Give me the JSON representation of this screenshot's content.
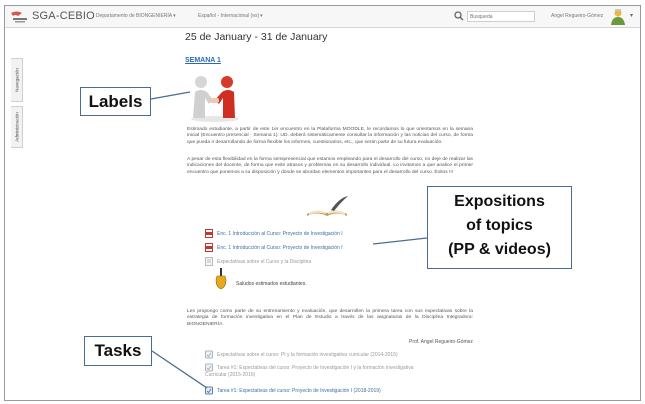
{
  "navbar": {
    "brand": "SGA-CEBIO",
    "menus": [
      {
        "label": "Departamento de BIONGENIERÍA",
        "caret": "▾"
      },
      {
        "label": "Español - Internacional (es)",
        "caret": "▾"
      }
    ],
    "search_placeholder": "Busqueda",
    "user_name": "Angel Regueiro-Gómez",
    "user_caret": "▾"
  },
  "sidebar": {
    "tabs": [
      {
        "label": "Navegación"
      },
      {
        "label": "Administración"
      }
    ]
  },
  "course": {
    "week_title": "25 de January - 31 de January",
    "section_link": "SEMANA 1",
    "intro_paragraph": "Estimado estudiante, a partir de este 1er encuentro en la Plataforma MOODLE, le recordamos lo que orientamos en la semana inicial (Encuentro presencial - Semana 1): UD. deberá sistemáticamente consultar la información y las noticias del curso, de forma que pueda ir desarrollando de forma flexible los informes, cuestionarios, etc., que serán parte de su futura evaluación.",
    "flex_paragraph": "A pesar de esta flexibilidad en la forma semipresencial que estamos empleando para el desarrollo del curso, no deje de realizar las indicaciones del docente, de forma que evite atrasos y problemas en su desarrollo individual. Lo invitamos a que analice el primer encuentro que ponemos a su disposición y donde se abordan elementos importantes para el desarrollo del curso. Éxitos !!!",
    "resources": [
      {
        "label": "Enc. 1 Introducción al Curso: Proyecto de Investigación I",
        "icon": "pdf-icon"
      },
      {
        "label": "Enc. 1 Introducción al Curso: Proyecto de Investigación I",
        "icon": "pdf-icon"
      },
      {
        "label": "Expectativas sobre el Curso y la Disciplina",
        "icon": "document-icon"
      }
    ],
    "greeting": "Saludos estimados estudiantes.",
    "task_paragraph": "Les propongo como parte de su entrenamiento y evaluación, que desarrollen la primera tarea con sus expectativas sobre la estrategia de formación investigativa en el Plan de Estudio a través de las asignaturas de la Disciplina Integradora: BIONGENIERÍA.",
    "signature": "Prof. Angel Regueiro-Gómez",
    "tasks": [
      {
        "label": "Expectativas sobre el curso: PI y la formación investigativa curricular (2014-2015)",
        "icon": "assignment-icon"
      },
      {
        "label": "Tarea #1: Expectativas del curso: Proyecto de Investigación I y la formación investigativa",
        "label2": "Curricular (2015-2016)",
        "icon": "assignment-icon"
      },
      {
        "label": "Tarea #1: Expectativas del curso: Proyecto de Investigación I (2018-2019)",
        "icon": "assignment-icon"
      }
    ]
  },
  "callouts": {
    "labels": "Labels",
    "expositions": [
      "Expositions",
      "of topics",
      "(PP & videos)"
    ],
    "tasks": "Tasks"
  },
  "colors": {
    "link": "#2a6ab5",
    "callout_border": "#4a6c8f",
    "pdf_red": "#c0392b"
  }
}
